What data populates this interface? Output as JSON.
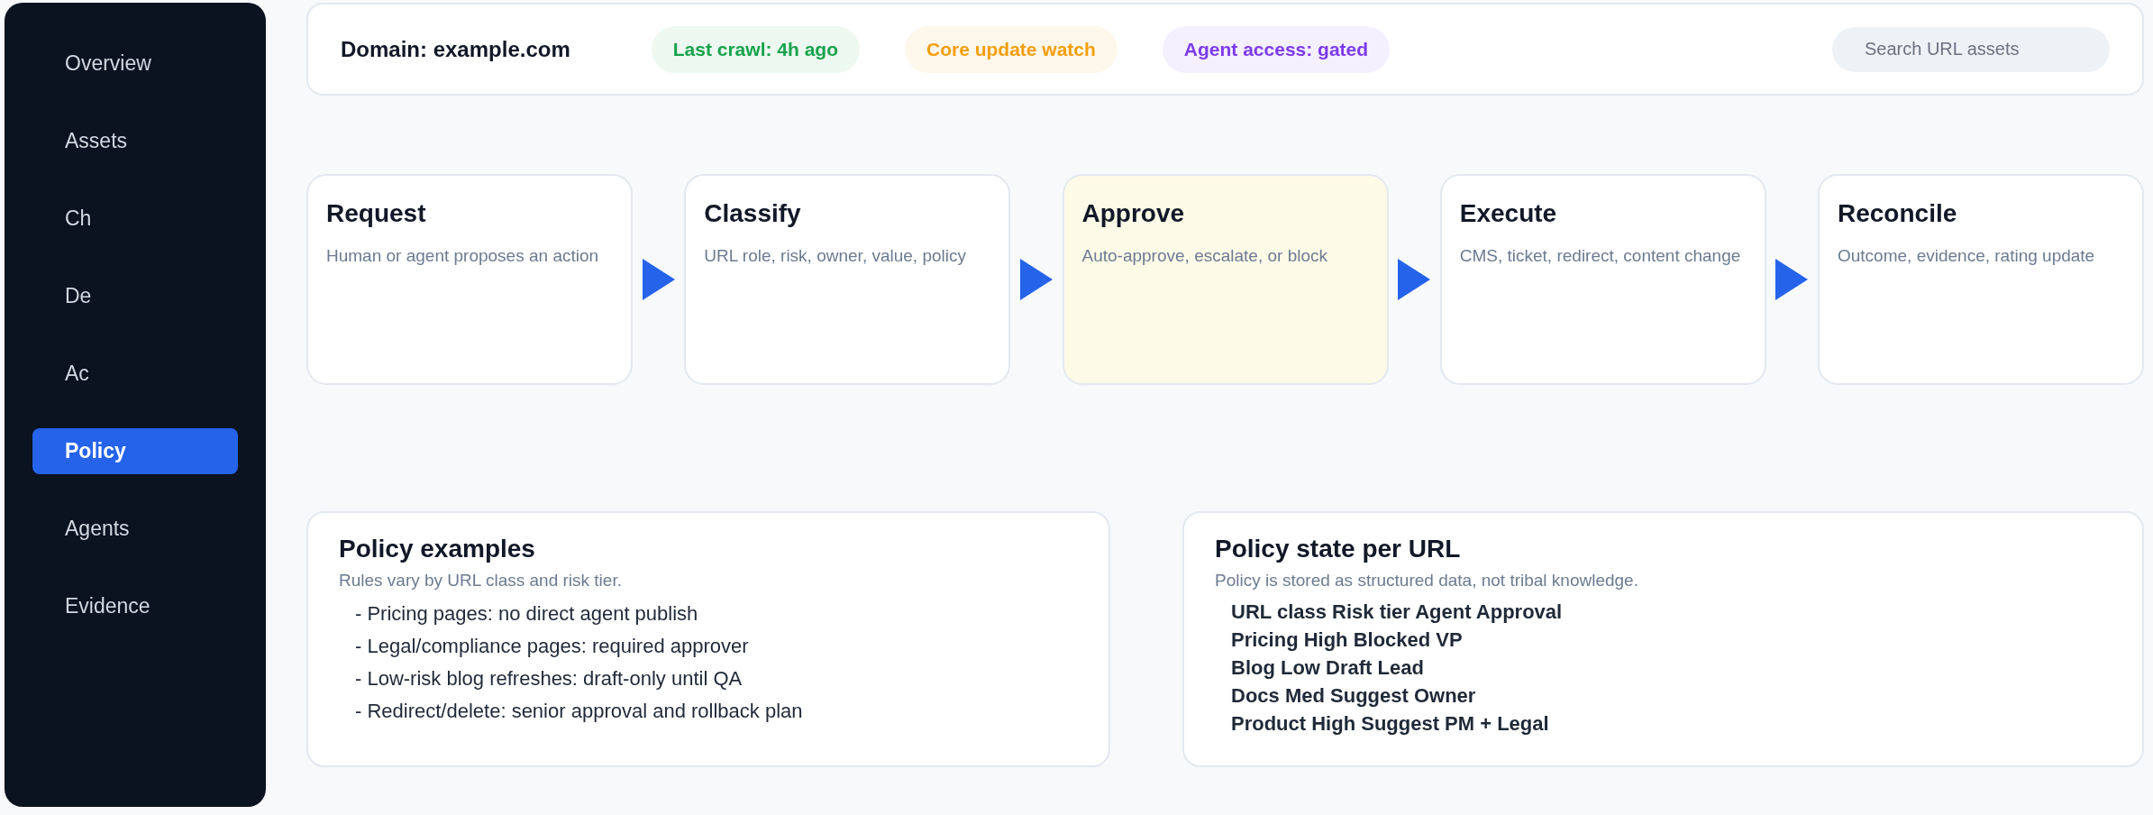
{
  "sidebar": {
    "items": [
      {
        "label": "Overview",
        "selected": false
      },
      {
        "label": "Assets",
        "selected": false
      },
      {
        "label": "Ch",
        "selected": false
      },
      {
        "label": "De",
        "selected": false
      },
      {
        "label": "Ac",
        "selected": false
      },
      {
        "label": "Policy",
        "selected": true
      },
      {
        "label": "Agents",
        "selected": false
      },
      {
        "label": "Evidence",
        "selected": false
      }
    ]
  },
  "top_bar": {
    "domain": "Domain: example.com",
    "badges": [
      {
        "label": "Last crawl: 4h ago",
        "color": "#16a34a"
      },
      {
        "label": "Core update watch",
        "color": "#f59e0b"
      },
      {
        "label": "Agent access: gated",
        "color": "#7c3aed"
      }
    ],
    "search": {
      "placeholder": "Search URL assets"
    }
  },
  "flow": {
    "steps": [
      {
        "title": "Request",
        "description": "Human or agent proposes an action",
        "highlighted": false
      },
      {
        "title": "Classify",
        "description": "URL role, risk, owner, value, policy",
        "highlighted": false
      },
      {
        "title": "Approve",
        "description": "Auto-approve, escalate, or block",
        "highlighted": true
      },
      {
        "title": "Execute",
        "description": "CMS, ticket, redirect, content change",
        "highlighted": false
      },
      {
        "title": "Reconcile",
        "description": "Outcome, evidence, rating update",
        "highlighted": false
      }
    ]
  },
  "policy_examples": {
    "title": "Policy examples",
    "subtitle": "Rules vary by URL class and risk tier.",
    "items": [
      "- Pricing pages: no direct agent publish",
      "- Legal/compliance pages: required approver",
      "- Low-risk blog refreshes: draft-only until QA",
      "- Redirect/delete: senior approval and rollback plan"
    ]
  },
  "policy_state": {
    "title": "Policy state per URL",
    "subtitle": "Policy is stored as structured data, not tribal knowledge.",
    "rows": [
      "URL class Risk tier Agent Approval",
      "Pricing High Blocked VP",
      "Blog Low Draft Lead",
      "Docs Med Suggest Owner",
      "Product High Suggest PM + Legal"
    ]
  }
}
